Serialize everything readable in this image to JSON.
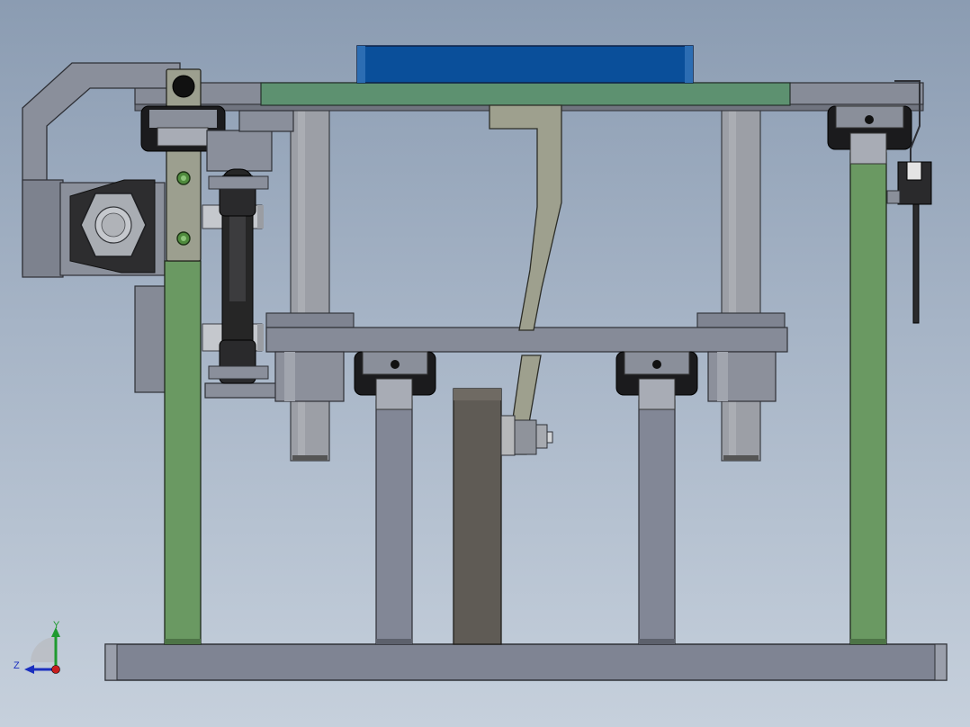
{
  "triad": {
    "y_label": "Y",
    "z_label": "Z"
  },
  "colors": {
    "frame_green": "#6a9962",
    "rail_green": "#5d9170",
    "steel_grey": "#808592",
    "light_steel": "#9a9fa9",
    "shaft_grey": "#9c9fa6",
    "dark_block": "#5f5b55",
    "lever_khaki": "#9ea08e",
    "blue_plate": "#0a4f9a",
    "belt_black": "#262626",
    "axis_y": "#1f9a2f",
    "axis_z": "#1a2fbf",
    "axis_x": "#c81e1e"
  }
}
